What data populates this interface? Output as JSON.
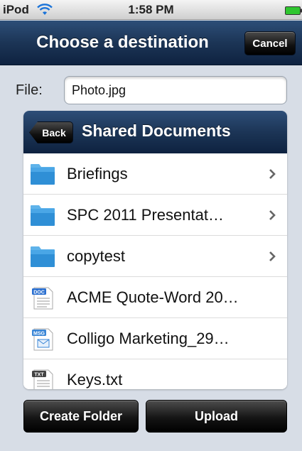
{
  "status_bar": {
    "carrier": "iPod",
    "time": "1:58 PM",
    "wifi_icon": "wifi-icon",
    "battery_icon": "battery-icon",
    "battery_color": "#2fc62f"
  },
  "nav": {
    "title": "Choose a destination",
    "cancel_label": "Cancel"
  },
  "file": {
    "label": "File:",
    "value": "Photo.jpg"
  },
  "folder_panel": {
    "back_label": "Back",
    "title": "Shared Documents",
    "items": [
      {
        "label": "Briefings",
        "icon": "folder-icon",
        "type": "folder"
      },
      {
        "label": "SPC 2011 Presentat…",
        "icon": "folder-icon",
        "type": "folder"
      },
      {
        "label": "copytest",
        "icon": "folder-icon",
        "type": "folder"
      },
      {
        "label": "ACME Quote-Word 20…",
        "icon": "doc-file-icon",
        "type": "file",
        "badge": "DOC"
      },
      {
        "label": "Colligo Marketing_29…",
        "icon": "msg-file-icon",
        "type": "file",
        "badge": "MSG"
      },
      {
        "label": "Keys.txt",
        "icon": "txt-file-icon",
        "type": "file",
        "badge": "TXT"
      }
    ]
  },
  "actions": {
    "create_folder_label": "Create Folder",
    "upload_label": "Upload"
  },
  "colors": {
    "nav_bar": "#1c3556",
    "background": "#d7dde6",
    "folder_blue": "#2f8fd6"
  }
}
